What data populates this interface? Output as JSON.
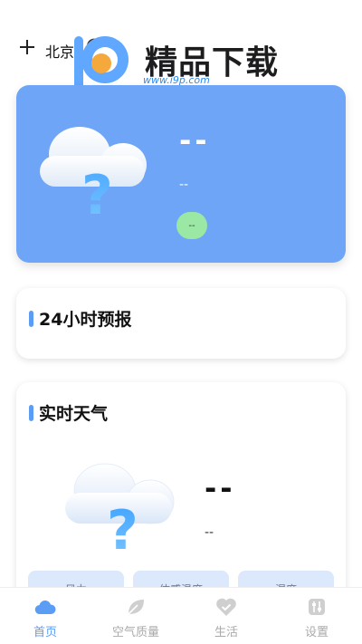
{
  "header": {
    "city": "北京"
  },
  "watermark": {
    "brand": "精品下载",
    "url": "www.i9p.com"
  },
  "hero": {
    "temperature": "--",
    "description": "--",
    "aqi": "--"
  },
  "forecast_card": {
    "title": "24小时预报"
  },
  "realtime_card": {
    "title": "实时天气",
    "temperature": "--",
    "description": "--",
    "chips": [
      "风力",
      "体感温度",
      "湿度"
    ]
  },
  "bottom_nav": {
    "items": [
      {
        "label": "首页",
        "icon": "cloud-icon",
        "active": true
      },
      {
        "label": "空气质量",
        "icon": "leaf-icon",
        "active": false
      },
      {
        "label": "生活",
        "icon": "heart-check-icon",
        "active": false
      },
      {
        "label": "设置",
        "icon": "settings-sliders-icon",
        "active": false
      }
    ]
  },
  "colors": {
    "accent": "#5b9cf5",
    "hero_bg": "#6ea5f6",
    "aqi_badge": "#9be8a4",
    "chip_bg": "#dce8fb"
  }
}
